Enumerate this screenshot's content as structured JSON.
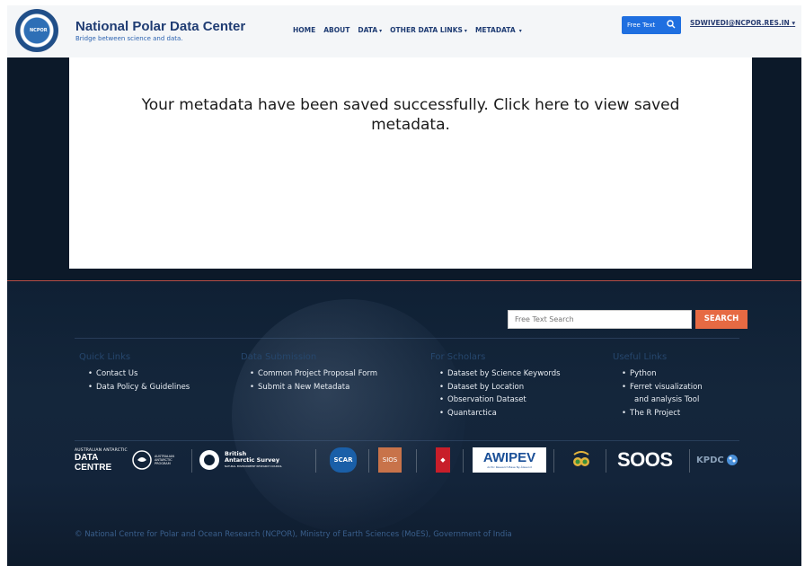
{
  "header": {
    "title": "National Polar Data Center",
    "tagline": "Bridge between science and data.",
    "logo_text": "NCPOR",
    "nav": [
      {
        "label": "HOME",
        "dropdown": false
      },
      {
        "label": "ABOUT",
        "dropdown": false
      },
      {
        "label": "DATA",
        "dropdown": true
      },
      {
        "label": "OTHER DATA LINKS",
        "dropdown": true
      },
      {
        "label": "METADATA",
        "dropdown": true
      }
    ],
    "free_text_label": "Free Text",
    "user": "SDWIVEDI@NCPOR.RES.IN"
  },
  "main": {
    "message": "Your metadata have been saved successfully. Click here to view saved metadata."
  },
  "footer": {
    "search_placeholder": "Free Text Search",
    "search_button": "SEARCH",
    "columns": [
      {
        "title": "Quick Links",
        "items": [
          "Contact Us",
          "Data Policy & Guidelines"
        ]
      },
      {
        "title": "Data Submission",
        "items": [
          "Common Project Proposal Form",
          "Submit a New Metadata"
        ]
      },
      {
        "title": "For Scholars",
        "items": [
          "Dataset by Science Keywords",
          "Dataset by Location",
          "Observation Dataset",
          "Quantarctica"
        ]
      },
      {
        "title": "Useful Links",
        "items": [
          "Python",
          "Ferret visualization",
          "and analysis Tool",
          "The R Project"
        ]
      }
    ],
    "partner_logos": {
      "aadc": [
        "AUSTRALIAN ANTARCTIC",
        "DATA CENTRE"
      ],
      "aap": "AUSTRALIAN ANTARCTIC PROGRAM",
      "bas": [
        "British",
        "Antarctic Survey",
        "NATURAL ENVIRONMENT RESEARCH COUNCIL"
      ],
      "scar": "SCAR",
      "sios": "SIOS",
      "awipev": "AWIPEV",
      "awipev_sub": "Arctic Research Base Ny-Ålesund",
      "soos": "SOOS",
      "kpdc": "KPDC"
    },
    "copyright": "© National Centre for Polar and Ocean Research (NCPOR), Ministry of Earth Sciences (MoES), Government of India"
  },
  "colors": {
    "brand_navy": "#1f3c73",
    "accent_blue": "#1f6fe0",
    "search_orange": "#e66a43",
    "dark_band": "#0c1929"
  }
}
